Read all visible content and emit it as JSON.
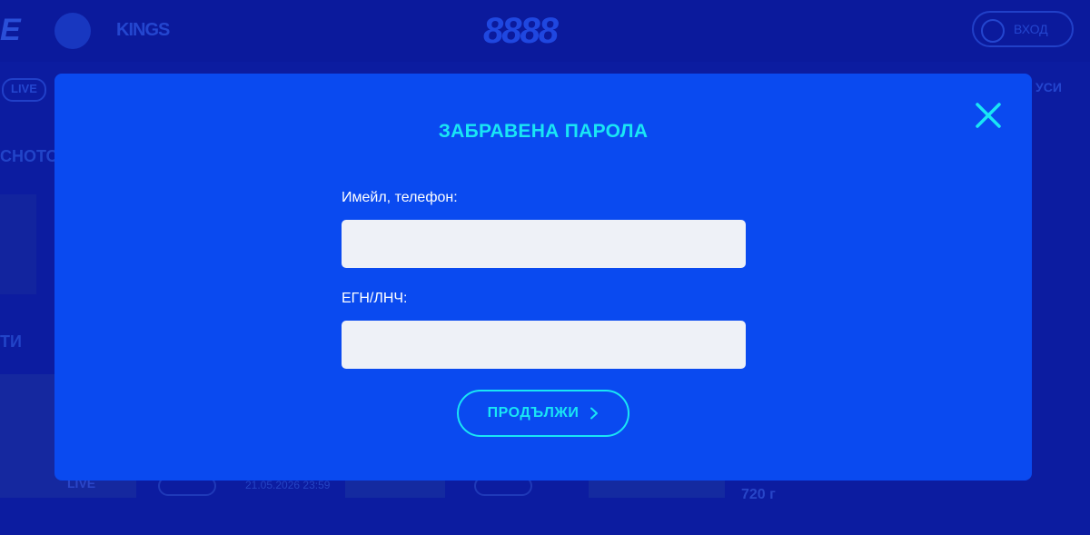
{
  "background": {
    "logo_letter": "E",
    "kings_logo_text": "KINGS",
    "brand_logo_text": "8888",
    "login_button_label": "ВХОД",
    "live_badge": "LIVE",
    "promo_link": "УСИ",
    "section_1_title": "СНОТО",
    "section_2_title": "ТИ",
    "card_live_label": "LIVE",
    "card_date": "21.05.2026 23:59",
    "card_price": "720 г"
  },
  "modal": {
    "title": "ЗАБРАВЕНА ПАРОЛА",
    "close_icon": "close-icon",
    "fields": {
      "email": {
        "label": "Имейл, телефон:",
        "value": "",
        "placeholder": ""
      },
      "egn": {
        "label": "ЕГН/ЛНЧ:",
        "value": "",
        "placeholder": ""
      }
    },
    "continue_button": {
      "label": "ПРОДЪЛЖИ",
      "icon": "chevron-right-icon"
    },
    "colors": {
      "modal_bg": "#0a4af0",
      "accent": "#19e6f5",
      "input_bg": "#eef1f7",
      "page_overlay": "#0a1aa8"
    }
  }
}
